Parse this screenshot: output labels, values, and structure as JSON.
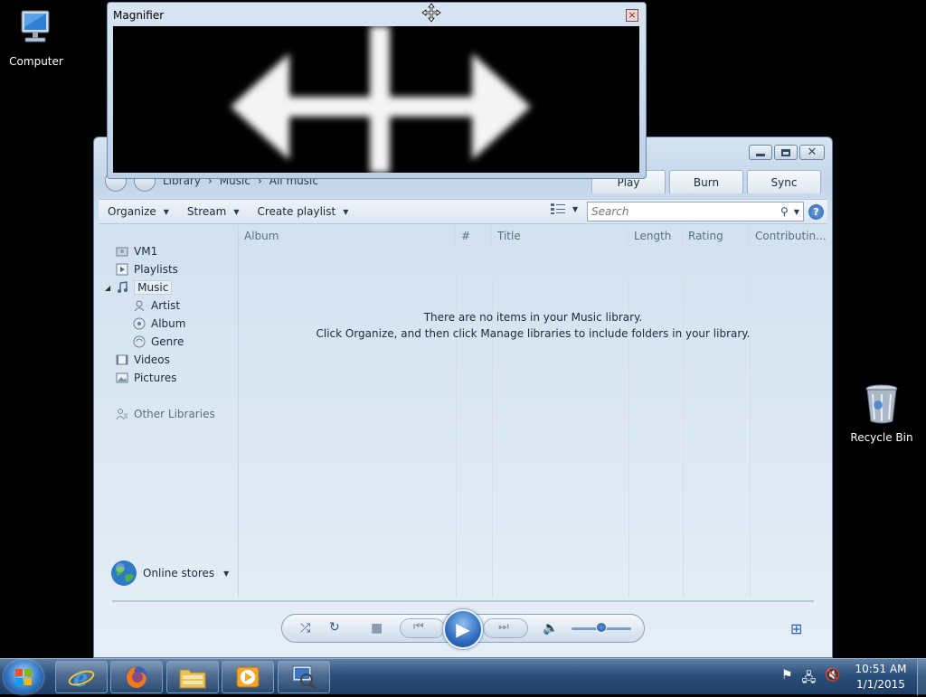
{
  "desktop": {
    "computer_label": "Computer",
    "recycle_label": "Recycle Bin"
  },
  "magnifier": {
    "title": "Magnifier",
    "close_glyph": "×"
  },
  "wmp": {
    "breadcrumb": [
      "Library",
      "Music",
      "All music"
    ],
    "tabs": [
      "Play",
      "Burn",
      "Sync"
    ],
    "toolbar": {
      "organize": "Organize",
      "stream": "Stream",
      "create_playlist": "Create playlist",
      "search_placeholder": "Search"
    },
    "nav": {
      "vm1": "VM1",
      "playlists": "Playlists",
      "music": "Music",
      "artist": "Artist",
      "album": "Album",
      "genre": "Genre",
      "videos": "Videos",
      "pictures": "Pictures",
      "other_libraries": "Other Libraries",
      "online_stores": "Online stores"
    },
    "columns": [
      "Album",
      "#",
      "Title",
      "Length",
      "Rating",
      "Contributin..."
    ],
    "empty_line1": "There are no items in your Music library.",
    "empty_line2": "Click Organize, and then click Manage libraries to include folders in your library.",
    "volume_level": 0.5
  },
  "taskbar": {
    "time": "10:51 AM",
    "date": "1/1/2015",
    "pinned": [
      "internet-explorer",
      "firefox",
      "file-explorer",
      "windows-media-player",
      "magnifier"
    ]
  }
}
